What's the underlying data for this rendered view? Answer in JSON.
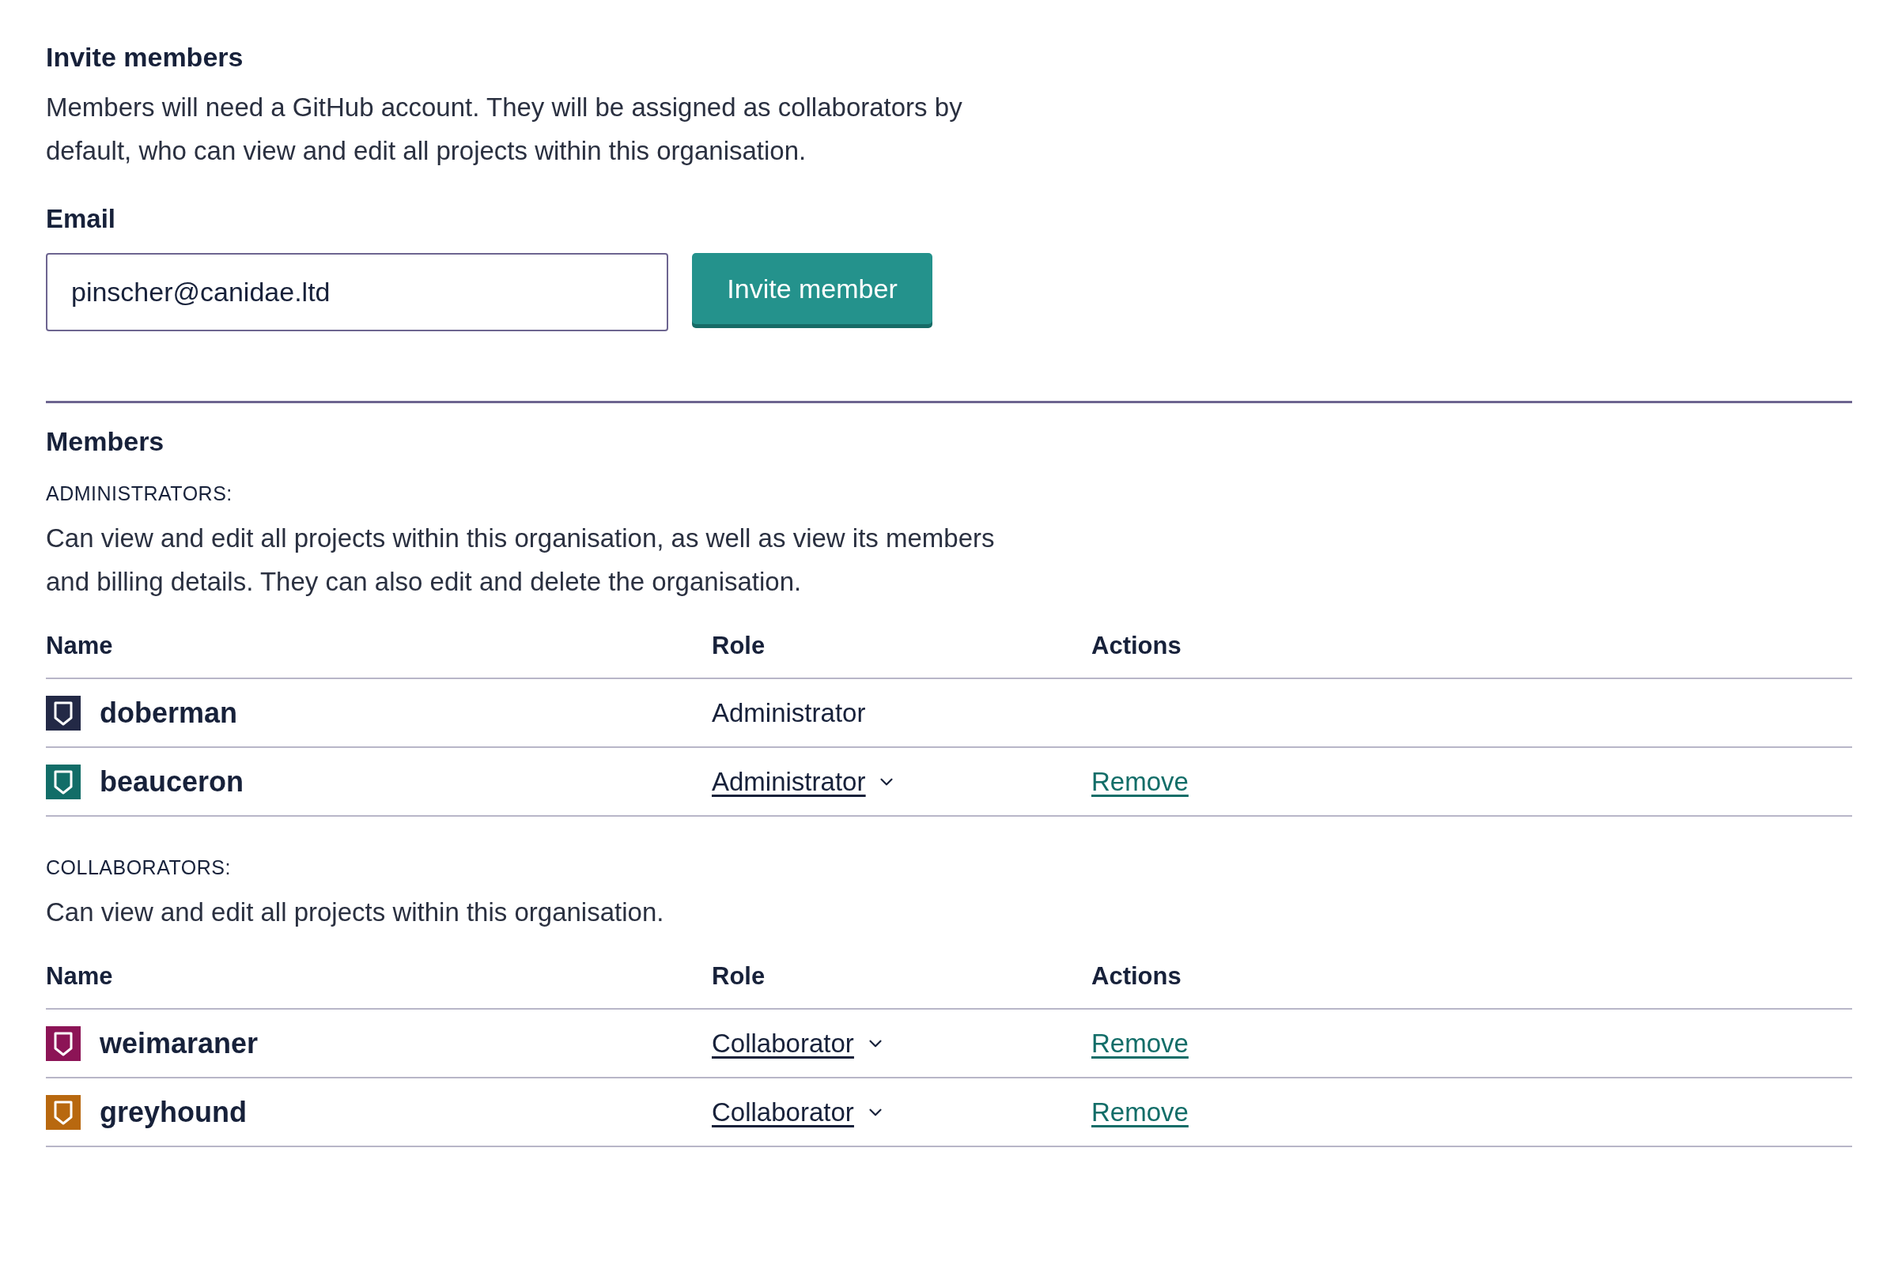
{
  "invite": {
    "title": "Invite members",
    "description": "Members will need a GitHub account. They will be assigned as collaborators by default, who can view and edit all projects within this organisation.",
    "email_label": "Email",
    "email_value": "pinscher@canidae.ltd",
    "button": "Invite member"
  },
  "members": {
    "title": "Members",
    "groups": [
      {
        "label": "ADMINISTRATORS:",
        "description": "Can view and edit all projects within this organisation, as well as view its members and billing details. They can also edit and delete the organisation.",
        "columns": [
          "Name",
          "Role",
          "Actions"
        ],
        "rows": [
          {
            "name": "doberman",
            "color": "#232946",
            "kind": "static",
            "role": "Administrator"
          },
          {
            "name": "beauceron",
            "color": "#126d68",
            "kind": "editable",
            "role": "Administrator",
            "action": "Remove"
          }
        ]
      },
      {
        "label": "COLLABORATORS:",
        "description": "Can view and edit all projects within this organisation.",
        "columns": [
          "Name",
          "Role",
          "Actions"
        ],
        "rows": [
          {
            "name": "weimaraner",
            "color": "#8c1456",
            "kind": "editable",
            "role": "Collaborator",
            "action": "Remove"
          },
          {
            "name": "greyhound",
            "color": "#b8680f",
            "kind": "editable",
            "role": "Collaborator",
            "action": "Remove"
          }
        ]
      }
    ]
  }
}
